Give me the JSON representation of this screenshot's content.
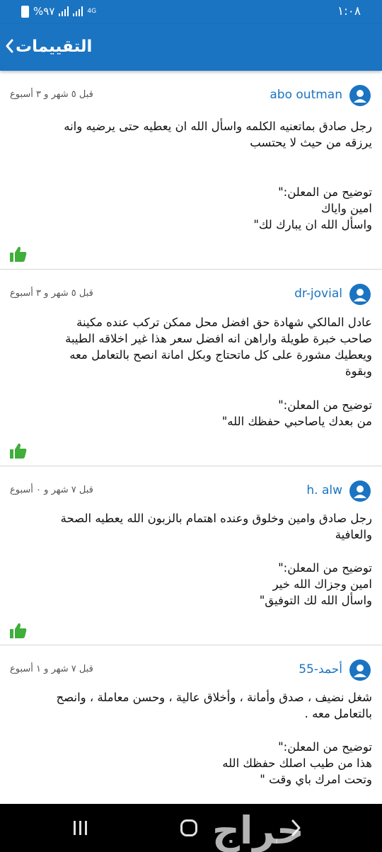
{
  "status_bar": {
    "time": "١:٠٨",
    "battery": "%٩٧",
    "network": "4G"
  },
  "app_bar": {
    "title": "التقييمات",
    "back_icon": "chevron-left-icon"
  },
  "reviews": [
    {
      "author": "abo outman",
      "date": "قبل ٥ شهر و ٣ أسبوع",
      "body": [
        "رجل صادق بماتعنيه الكلمه واسأل الله ان يعطيه حتى يرضيه وانه",
        "يرزقه من حيث لا يحتسب"
      ],
      "reply": [
        "توضيح من المعلن:\"",
        "امين واياك",
        "واسأل الله ان يبارك لك\""
      ]
    },
    {
      "author": "dr-jovial",
      "date": "قبل ٥ شهر و ٣ أسبوع",
      "body": [
        "عادل المالكي شهادة حق افضل محل ممكن تركب عنده مكينة",
        "صاحب خبرة طويلة واراهن انه افضل سعر هذا غير اخلاقه الطيبة",
        "ويعطيك مشورة على كل ماتحتاج وبكل امانة انصح بالتعامل معه",
        "وبقوة"
      ],
      "reply": [
        "توضيح من المعلن:\"",
        "من بعدك ياصاحبي حفظك الله\""
      ]
    },
    {
      "author": "h. alw",
      "date": "قبل ٧ شهر و ٠ أسبوع",
      "body": [
        "رجل صادق وامين وخلوق وعنده اهتمام بالزبون الله يعطيه الصحة",
        "والعافية"
      ],
      "reply": [
        "توضيح من المعلن:\"",
        "امين وجزاك الله خير",
        "واسأل الله لك التوفيق\""
      ]
    },
    {
      "author": "أحمد-55",
      "date": "قبل ٧ شهر و ١ أسبوع",
      "body": [
        "شغل نضيف ، صدق وأمانة ، وأخلاق عالية ، وحسن معاملة ، وانصح",
        "بالتعامل معه ."
      ],
      "reply": [
        "توضيح من المعلن:\"",
        "هذا من طيب اصلك حفظك الله",
        "وتحت امرك باي وقت \""
      ]
    }
  ],
  "icons": {
    "like": "thumbs-up-icon",
    "avatar": "user-avatar-icon"
  },
  "colors": {
    "primary": "#1a74c2",
    "like": "#3fae3a"
  },
  "nav_bar": {
    "watermark": "حراج"
  }
}
